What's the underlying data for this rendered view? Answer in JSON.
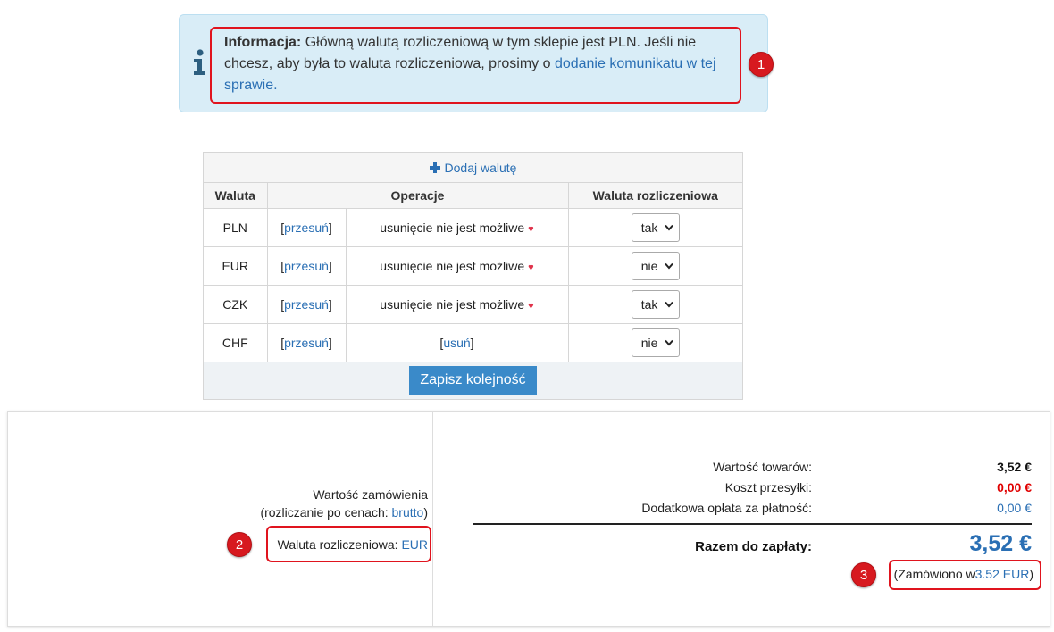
{
  "info": {
    "bold": "Informacja:",
    "text": " Główną walutą rozliczeniową w tym sklepie jest PLN. Jeśli nie chcesz, aby była to waluta rozliczeniowa, prosimy o ",
    "link": "dodanie komunikatu w tej sprawie."
  },
  "currency_table": {
    "add_label": "Dodaj walutę",
    "headers": [
      "Waluta",
      "Operacje",
      "Waluta rozliczeniowa"
    ],
    "rows": [
      {
        "code": "PLN",
        "move": "przesuń",
        "op": "usunięcie nie jest możliwe",
        "op_link": false,
        "settlement": "tak"
      },
      {
        "code": "EUR",
        "move": "przesuń",
        "op": "usunięcie nie jest możliwe",
        "op_link": false,
        "settlement": "nie"
      },
      {
        "code": "CZK",
        "move": "przesuń",
        "op": "usunięcie nie jest możliwe",
        "op_link": false,
        "settlement": "tak"
      },
      {
        "code": "CHF",
        "move": "przesuń",
        "op": "usuń",
        "op_link": true,
        "settlement": "nie"
      }
    ],
    "save_label": "Zapisz kolejność"
  },
  "order": {
    "value_title": "Wartość zamówienia",
    "pricing_prefix": "(rozliczanie po cenach: ",
    "pricing_link": "brutto",
    "pricing_suffix": ")",
    "settlement_label": "Waluta rozliczeniowa: ",
    "settlement_value": "EUR",
    "goods_label": "Wartość towarów:",
    "goods_value": "3,52 €",
    "shipping_label": "Koszt przesyłki:",
    "shipping_value": "0,00 €",
    "payment_label": "Dodatkowa opłata za płatność:",
    "payment_value": "0,00 €",
    "total_label": "Razem do zapłaty:",
    "total_value": "3,52 €",
    "ordered_prefix": "(Zamówiono w",
    "ordered_value": "3.52 EUR",
    "ordered_suffix": ")"
  },
  "badges": [
    "1",
    "2",
    "3"
  ],
  "colors": {
    "accent": "#2a6fb4",
    "highlight": "#e0141e",
    "info_bg": "#d9edf7",
    "shipping_red": "#e00000"
  }
}
